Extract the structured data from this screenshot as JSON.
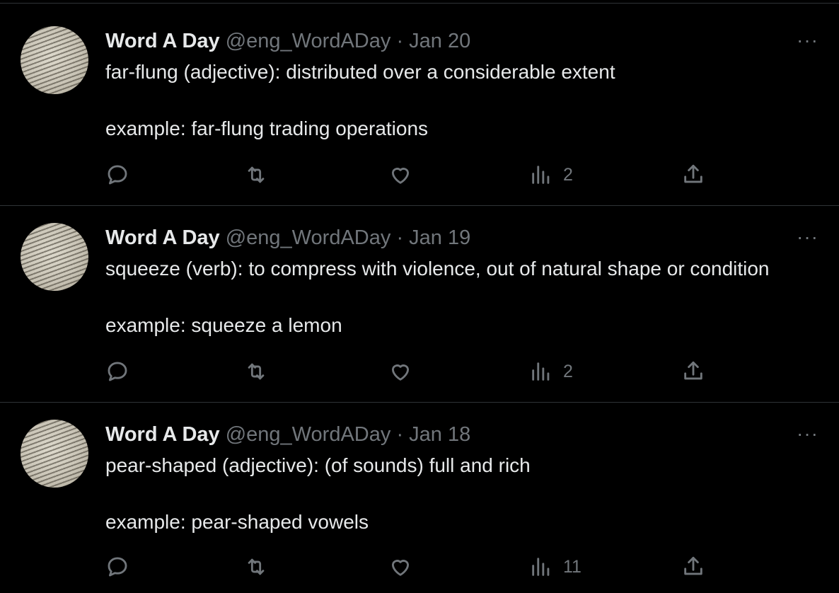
{
  "tweets": [
    {
      "name": "Word A Day",
      "handle": "@eng_WordADay",
      "separator": "·",
      "date": "Jan 20",
      "line1": "far-flung (adjective): distributed over a considerable extent",
      "line2": "example: far-flung trading operations",
      "views": "2"
    },
    {
      "name": "Word A Day",
      "handle": "@eng_WordADay",
      "separator": "·",
      "date": "Jan 19",
      "line1": "squeeze (verb): to compress with violence, out of natural shape or condition",
      "line2": "example: squeeze a lemon",
      "views": "2"
    },
    {
      "name": "Word A Day",
      "handle": "@eng_WordADay",
      "separator": "·",
      "date": "Jan 18",
      "line1": "pear-shaped (adjective): (of sounds) full and rich",
      "line2": "example: pear-shaped vowels",
      "views": "11"
    }
  ],
  "icons": {
    "more": "more-icon",
    "reply": "reply-icon",
    "retweet": "retweet-icon",
    "like": "heart-icon",
    "views": "views-icon",
    "share": "share-icon"
  },
  "colors": {
    "background": "#000000",
    "text": "#e7e9ea",
    "muted": "#71767b",
    "divider": "#2f3336"
  }
}
